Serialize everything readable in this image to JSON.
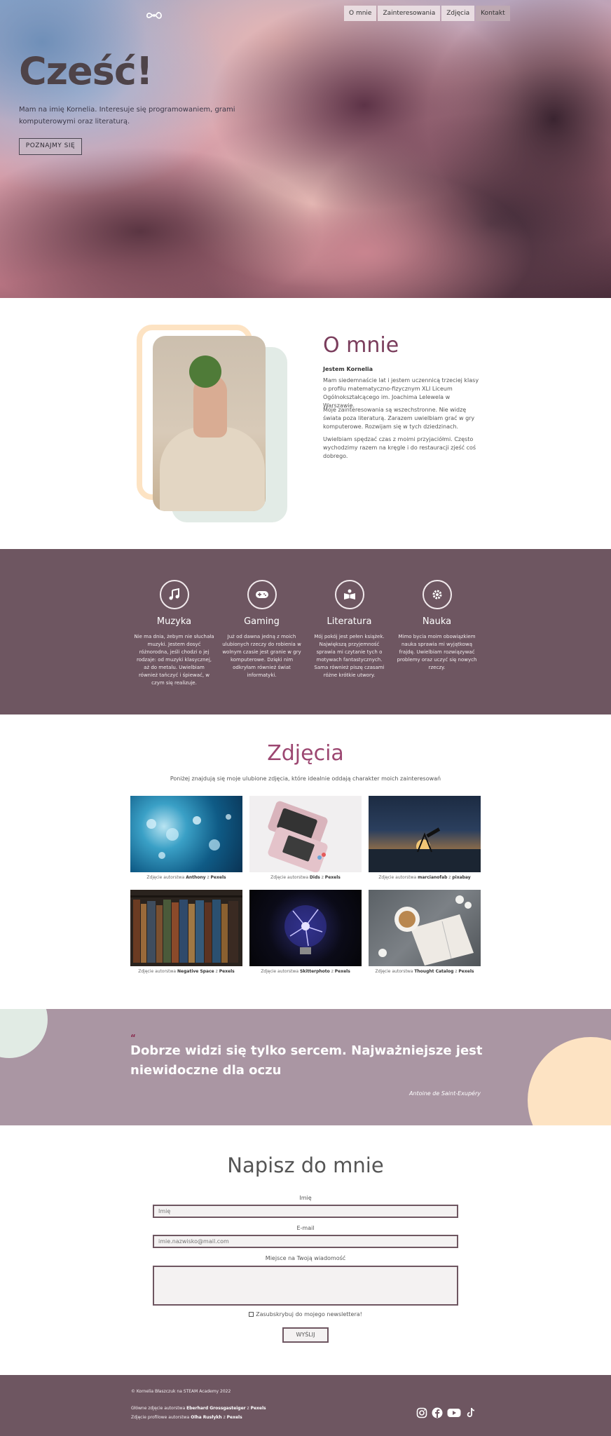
{
  "nav": {
    "logo_icon": "infinity-cloud-icon",
    "items": [
      {
        "label": "O mnie"
      },
      {
        "label": "Zainteresowania"
      },
      {
        "label": "Zdjęcia"
      },
      {
        "label": "Kontakt"
      }
    ]
  },
  "hero": {
    "title": "Cześć!",
    "intro": "Mam na imię Kornelia. Interesuje się programowaniem, grami komputerowymi oraz literaturą.",
    "button": "POZNAJMY SIĘ"
  },
  "about": {
    "title": "O mnie",
    "name": "Jestem Kornelia",
    "paragraphs": [
      "Mam siedemnaście lat i jestem uczennicą trzeciej klasy o profilu matematyczno-fizycznym XLI Liceum Ogólnokształcącego im. Joachima Lelewela w Warszawie.",
      "Moje zainteresowania są wszechstronne. Nie widzę świata poza literaturą. Zarazem uwielbiam grać w gry komputerowe. Rozwijam się w tych dziedzinach.",
      "Uwielbiam spędzać czas z moimi przyjaciółmi. Często wychodzimy razem na kręgle i do restauracji zjeść coś dobrego."
    ]
  },
  "interests": [
    {
      "icon": "music-note-icon",
      "title": "Muzyka",
      "text": "Nie ma dnia, żebym nie słuchała muzyki. Jestem dosyć różnorodna, jeśli chodzi o jej rodzaje: od muzyki klasycznej, aż do metalu. Uwielbiam również tańczyć i śpiewać, w czym się realizuje."
    },
    {
      "icon": "gamepad-icon",
      "title": "Gaming",
      "text": "Już od dawna jedną z moich ulubionych rzeczy do robienia w wolnym czasie jest granie w gry komputerowe. Dzięki nim odkryłam również świat informatyki."
    },
    {
      "icon": "book-reader-icon",
      "title": "Literatura",
      "text": "Mój pokój jest pełen książek. Największą przyjemność sprawia mi czytanie tych o motywach fantastycznych. Sama również piszę czasami różne krótkie utwory."
    },
    {
      "icon": "atom-gear-icon",
      "title": "Nauka",
      "text": "Mimo bycia moim obowiązkiem nauka sprawia mi wyjątkową frajdę. Uwielbiam rozwiązywać problemy oraz uczyć się nowych rzeczy."
    }
  ],
  "photos": {
    "title": "Zdjęcia",
    "subtitle": "Poniżej znajdują się moje ulubione zdjęcia, które idealnie oddają charakter moich zainteresowań",
    "items": [
      {
        "prefix": "Zdjęcie autorstwa ",
        "author": "Anthony",
        "suffix": " z ",
        "source": "Pexels"
      },
      {
        "prefix": "Zdjęcie autorstwa ",
        "author": "Dids",
        "suffix": " z ",
        "source": "Pexels"
      },
      {
        "prefix": "Zdjęcie autorstwa ",
        "author": "marcianofab",
        "suffix": " z ",
        "source": "pixabay"
      },
      {
        "prefix": "Zdjęcie autorstwa ",
        "author": "Negative Space",
        "suffix": " z ",
        "source": "Pexels"
      },
      {
        "prefix": "Zdjęcie autorstwa ",
        "author": "Skitterphoto",
        "suffix": " z ",
        "source": "Pexels"
      },
      {
        "prefix": "Zdjęcie autorstwa ",
        "author": "Thought Catalog",
        "suffix": " z ",
        "source": "Pexels"
      }
    ]
  },
  "quote": {
    "mark": "“",
    "text": "Dobrze widzi się tylko sercem. Najważniejsze jest niewidoczne dla oczu",
    "author": "Antoine de Saint-Exupéry"
  },
  "contact": {
    "title": "Napisz do mnie",
    "name_label": "Imię",
    "name_placeholder": "Imię",
    "email_label": "E-mail",
    "email_placeholder": "imie.nazwisko@mail.com",
    "message_label": "Miejsce na Twoją wiadomość",
    "newsletter": "Zasubskrybuj do mojego newslettera!",
    "send": "WYŚLIJ"
  },
  "footer": {
    "copyright": "© Kornelia Błaszczuk na STEAM Academy 2022",
    "bg_credit_prefix": "Główne zdjęcie autorstwa ",
    "bg_credit_author": "Eberhard Grossgasteiger",
    "bg_credit_source": "Pexels",
    "profile_credit_prefix": "Zdjęcie profilowe autorstwa ",
    "profile_credit_author": "Olha Rusłykh",
    "profile_credit_source": "Pexels",
    "social": [
      "instagram-icon",
      "facebook-icon",
      "youtube-icon",
      "tiktok-icon"
    ]
  },
  "colors": {
    "plum": "#6e5661",
    "mauve": "#aa96a3",
    "accent": "#7a3d5c",
    "peach": "#fde3c3",
    "mint": "#e2ebe6"
  }
}
